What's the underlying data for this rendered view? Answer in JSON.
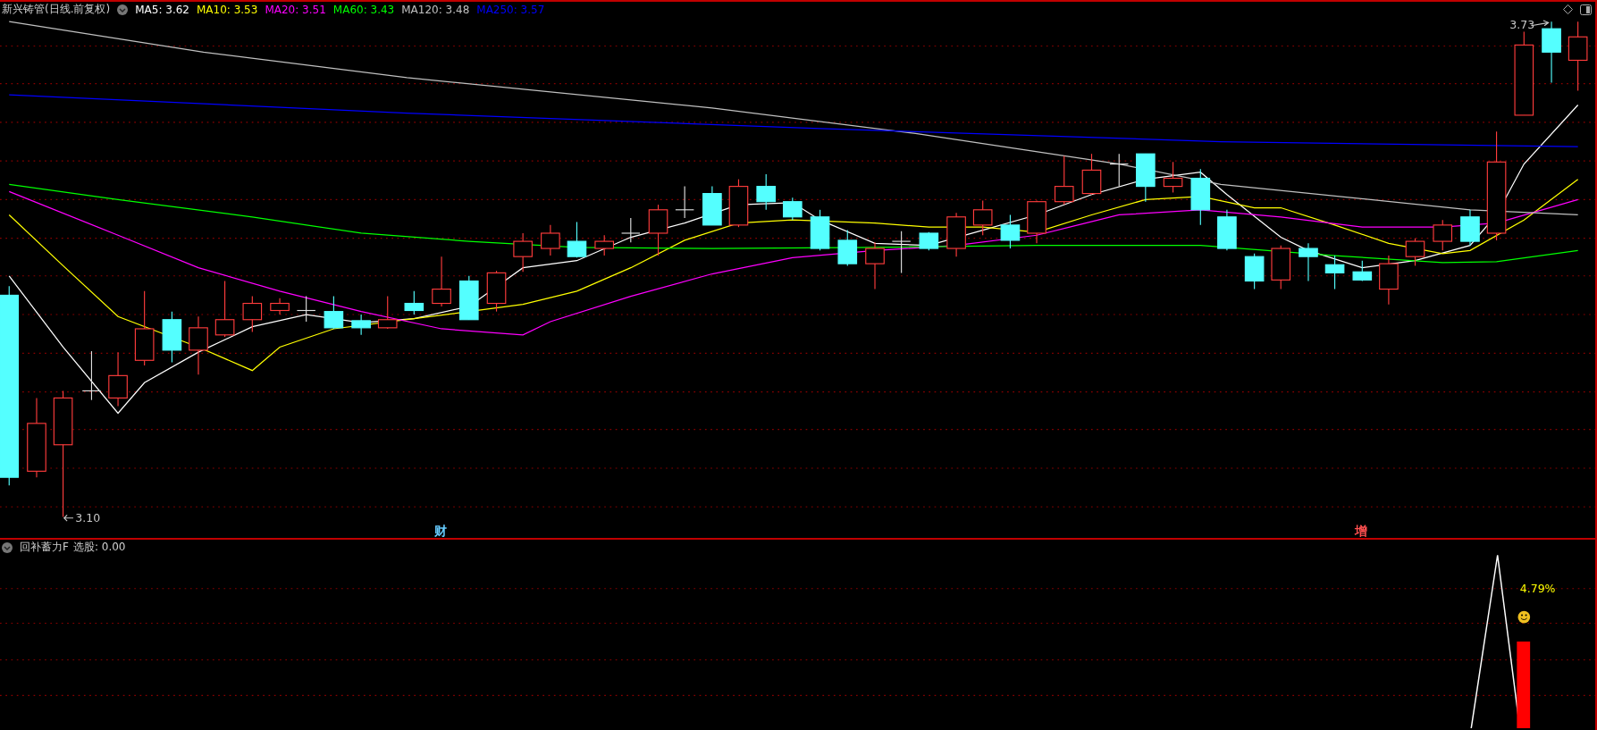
{
  "main_chart": {
    "title": "新兴铸管(日线.前复权)",
    "legend": [
      {
        "label": "MA5: 3.62",
        "color": "#ffffff"
      },
      {
        "label": "MA10: 3.53",
        "color": "#ffff00"
      },
      {
        "label": "MA20: 3.51",
        "color": "#ff00ff"
      },
      {
        "label": "MA60: 3.43",
        "color": "#00ff00"
      },
      {
        "label": "MA120: 3.48",
        "color": "#c0c0c0"
      },
      {
        "label": "MA250: 3.57",
        "color": "#0000ff"
      }
    ],
    "high_label": "3.73",
    "low_label": "3.10",
    "markers": [
      {
        "text": "财",
        "color": "#66ccff"
      },
      {
        "text": "增",
        "color": "#ff5050"
      }
    ]
  },
  "indicator": {
    "name": "回补蓄力F",
    "reading": "选股: 0.00",
    "value_label": "4.79%"
  }
}
